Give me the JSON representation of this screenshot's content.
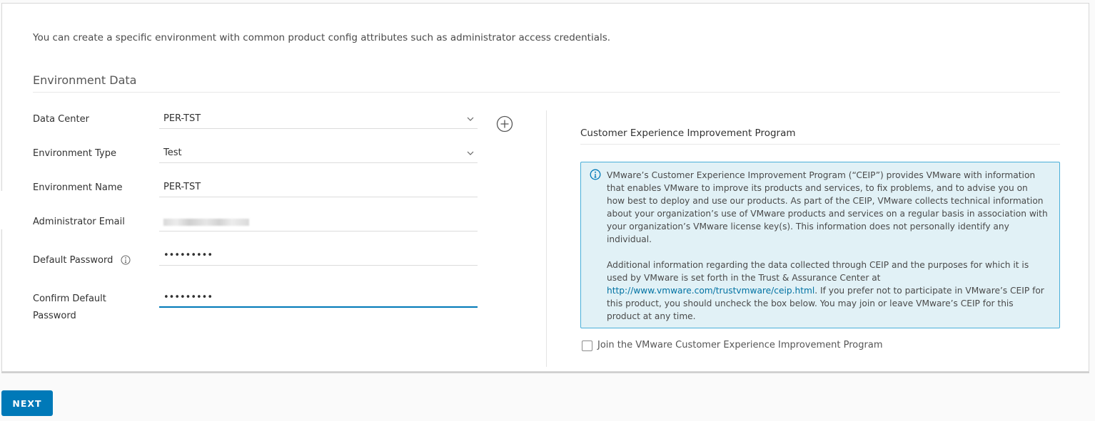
{
  "intro_text": "You can create a specific environment with common product config attributes such as administrator access credentials.",
  "section_title": "Environment Data",
  "form": {
    "data_center": {
      "label": "Data Center",
      "value": "PER-TST"
    },
    "environment_type": {
      "label": "Environment Type",
      "value": "Test"
    },
    "environment_name": {
      "label": "Environment Name",
      "value": "PER-TST"
    },
    "admin_email": {
      "label": "Administrator Email",
      "value": ""
    },
    "default_password": {
      "label": "Default Password",
      "value": "•••••••••"
    },
    "confirm_password": {
      "label_line1": "Confirm Default",
      "label_line2": "Password",
      "value": "•••••••••"
    }
  },
  "ceip": {
    "title": "Customer Experience Improvement Program",
    "paragraph1": "VMware’s Customer Experience Improvement Program (“CEIP”) provides VMware with information that enables VMware to improve its products and services, to fix problems, and to advise you on how best to deploy and use our products. As part of the CEIP, VMware collects technical information about your organization’s use of VMware products and services on a regular basis in association with your organization’s VMware license key(s). This information does not personally identify any individual.",
    "paragraph2_before": "Additional information regarding the data collected through CEIP and the purposes for which it is used by VMware is set forth in the Trust & Assurance Center at ",
    "link": "http://www.vmware.com/trustvmware/ceip.html",
    "paragraph2_after": ". If you prefer not to participate in VMware’s CEIP for this product, you should uncheck the box below. You may join or leave VMware’s CEIP for this product at any time.",
    "checkbox_label": "Join the VMware Customer Experience Improvement Program",
    "checked": false
  },
  "next_label": "NEXT",
  "colors": {
    "primary": "#0079b8",
    "info_bg": "#e1f1f6",
    "info_border": "#49afd9"
  }
}
